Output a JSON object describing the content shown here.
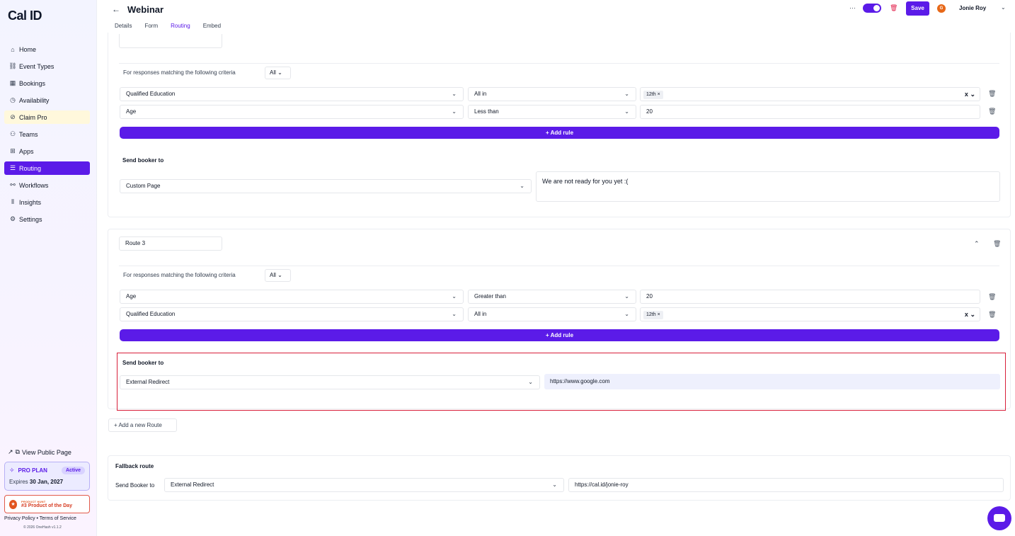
{
  "app": {
    "logo": "Cal ID"
  },
  "sidebar": {
    "items": [
      {
        "label": "Home",
        "icon": "home-icon",
        "glyph": "⌂"
      },
      {
        "label": "Event Types",
        "icon": "link-icon",
        "glyph": "⛓"
      },
      {
        "label": "Bookings",
        "icon": "calendar-icon",
        "glyph": "▦"
      },
      {
        "label": "Availability",
        "icon": "clock-icon",
        "glyph": "◷"
      },
      {
        "label": "Claim Pro",
        "icon": "badge-icon",
        "glyph": "⊘"
      },
      {
        "label": "Teams",
        "icon": "users-icon",
        "glyph": "⚇"
      },
      {
        "label": "Apps",
        "icon": "grid-icon",
        "glyph": "⊞"
      },
      {
        "label": "Routing",
        "icon": "routing-icon",
        "glyph": "☰"
      },
      {
        "label": "Workflows",
        "icon": "workflow-icon",
        "glyph": "⚯"
      },
      {
        "label": "Insights",
        "icon": "bar-chart-icon",
        "glyph": "⫴"
      },
      {
        "label": "Settings",
        "icon": "gear-icon",
        "glyph": "⚙"
      }
    ],
    "view_public": "View Public Page",
    "pro_plan": {
      "title": "PRO PLAN",
      "status": "Active",
      "expires_label": "Expires",
      "expires_date": "30 Jan, 2027"
    },
    "product_hunt": {
      "small": "PRODUCT HUNT",
      "large": "#3 Product of the Day"
    },
    "footer_links": "Privacy Policy • Terms of Service",
    "copyright": "© 2026 OneHash v1.1.2"
  },
  "header": {
    "title": "Webinar",
    "back_glyph": "←",
    "tabs": [
      "Details",
      "Form",
      "Routing",
      "Embed"
    ],
    "more": "···",
    "save": "Save",
    "user_initial": "G",
    "user_name": "Jonie Roy",
    "caret": "⌄"
  },
  "route2": {
    "criteria": "For responses matching the following criteria",
    "match": "All",
    "rules": [
      {
        "field": "Qualified Education",
        "op": "All in",
        "value": "12th ×"
      },
      {
        "field": "Age",
        "op": "Less than",
        "value": "20"
      }
    ],
    "add_rule": "+ Add rule",
    "send_label": "Send booker to",
    "destination": "Custom Page",
    "message": "We are not ready for you yet :("
  },
  "route3": {
    "name": "Route 3",
    "criteria": "For responses matching the following criteria",
    "match": "All",
    "rules": [
      {
        "field": "Age",
        "op": "Greater than",
        "value": "20"
      },
      {
        "field": "Qualified Education",
        "op": "All in",
        "value": "12th ×"
      }
    ],
    "add_rule": "+ Add rule",
    "send_label": "Send booker to",
    "destination": "External Redirect",
    "url": "https://www.google.com"
  },
  "add_route": "+ Add a new Route",
  "fallback": {
    "title": "Fallback route",
    "send_label": "Send Booker to",
    "destination": "External Redirect",
    "url": "https://cal.id/jonie-roy"
  },
  "icons": {
    "chevron": "⌄",
    "trash": "🗑",
    "clear": "x",
    "collapse": "⌃"
  },
  "colors": {
    "accent": "#5b1be8",
    "danger": "#e11d48",
    "highlight": "#d81f3a"
  }
}
